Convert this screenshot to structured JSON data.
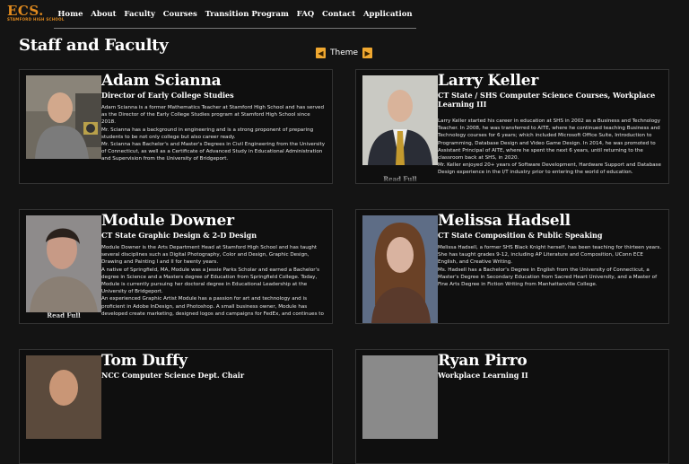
{
  "logo": {
    "text": "ECS.",
    "subtext": "STAMFORD HIGH SCHOOL"
  },
  "nav": [
    "Home",
    "About",
    "Faculty",
    "Courses",
    "Transition Program",
    "FAQ",
    "Contact",
    "Application"
  ],
  "page_title": "Staff and Faculty",
  "theme": {
    "label": "Theme",
    "prev_icon": "chevron-left-icon",
    "next_icon": "chevron-right-icon"
  },
  "read_full_label": "Read Full",
  "faculty": [
    {
      "name": "Adam Scianna",
      "role": "Director of Early College Studies",
      "bio": [
        "Adam Scianna is a former Mathematics Teacher at Stamford High School and has served as the Director of the Early College Studies program at Stamford High School since 2018.",
        "Mr. Scianna has a background in engineering and is a strong proponent of preparing students to be not only college but also career ready.",
        "Mr. Scianna has Bachelor's and Master's Degrees in Civil Engineering from the University of Connecticut, as well as a Certificate of Advanced Study in Educational Administration and Supervision from the University of Bridgeport."
      ]
    },
    {
      "name": "Larry Keller",
      "role": "CT State / SHS Computer Science Courses, Workplace Learning III",
      "bio": [
        "Larry Keller started his career in education at SHS in 2002 as a Business and Technology Teacher. In 2008, he was transferred to AITE, where he continued teaching Business and Technology courses for 6 years; which included Microsoft Office Suite, Introduction to Programming, Database Design and Video Game Design. In 2014, he was promoted to Assistant Principal of AITE, where he spent the next 6 years, until returning to the classroom back at SHS, in 2020.",
        "Mr. Keller enjoyed 20+ years of Software Development, Hardware Support and Database Design experience in the I/T industry prior to entering the world of education."
      ]
    },
    {
      "name": "Module Downer",
      "role": "CT State Graphic Design & 2-D Design",
      "bio": [
        "Module Downer is the Arts Department Head at Stamford High School and has taught several disciplines such as Digital Photography, Color and Design, Graphic Design, Drawing and Painting I and II for twenty years.",
        "A native of Springfield, MA, Module was a Jessie Parks Scholar and earned a Bachelor's degree in Science and a Masters degree of Education from Springfield College. Today, Module is currently pursuing her doctoral degree in Educational Leadership at the University of Bridgeport.",
        "An experienced Graphic Artist Module has a passion for art and technology and is proficient in Adobe InDesign, and Photoshop. A small business owner, Module has developed create marketing, designed logos and campaigns for FedEx, and continues to"
      ]
    },
    {
      "name": "Melissa Hadsell",
      "role": "CT State Composition & Public Speaking",
      "bio": [
        "Melissa Hadsell, a former SHS Black Knight herself, has been teaching for thirteen years. She has taught grades 9-12, including AP Literature and Composition, UConn ECE English, and Creative Writing.",
        "Ms. Hadsell has a Bachelor's Degree in English from the University of Connecticut, a Master's Degree in Secondary Education from Sacred Heart University, and a Master of Fine Arts Degree in Fiction Writing from Manhattanville College."
      ]
    },
    {
      "name": "Tom Duffy",
      "role": "NCC Computer Science Dept. Chair",
      "bio": []
    },
    {
      "name": "Ryan Pirro",
      "role": "Workplace Learning II",
      "bio": []
    }
  ],
  "colors": {
    "accent": "#e08a1e",
    "background": "#141414",
    "card": "#0f0f0f",
    "theme_button": "#f0a830"
  }
}
